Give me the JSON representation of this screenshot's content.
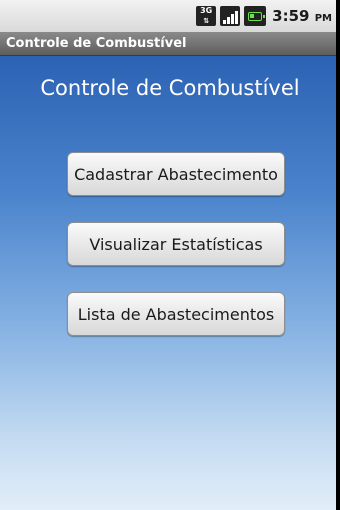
{
  "status_bar": {
    "network_icon": "3g-icon",
    "network_label": "3G",
    "signal_icon": "signal-bars-icon",
    "battery_icon": "battery-icon",
    "time": "3:59",
    "ampm": "PM"
  },
  "app": {
    "title": "Controle de Combustível"
  },
  "main": {
    "heading": "Controle de Combustível",
    "buttons": [
      {
        "label": "Cadastrar Abastecimento"
      },
      {
        "label": "Visualizar Estatísticas"
      },
      {
        "label": "Lista de Abastecimentos"
      }
    ]
  },
  "colors": {
    "background_top": "#2c62b3",
    "background_bottom": "#e2eef9",
    "title_bar": "#6e6e6e",
    "battery_accent": "#6ee04a"
  }
}
